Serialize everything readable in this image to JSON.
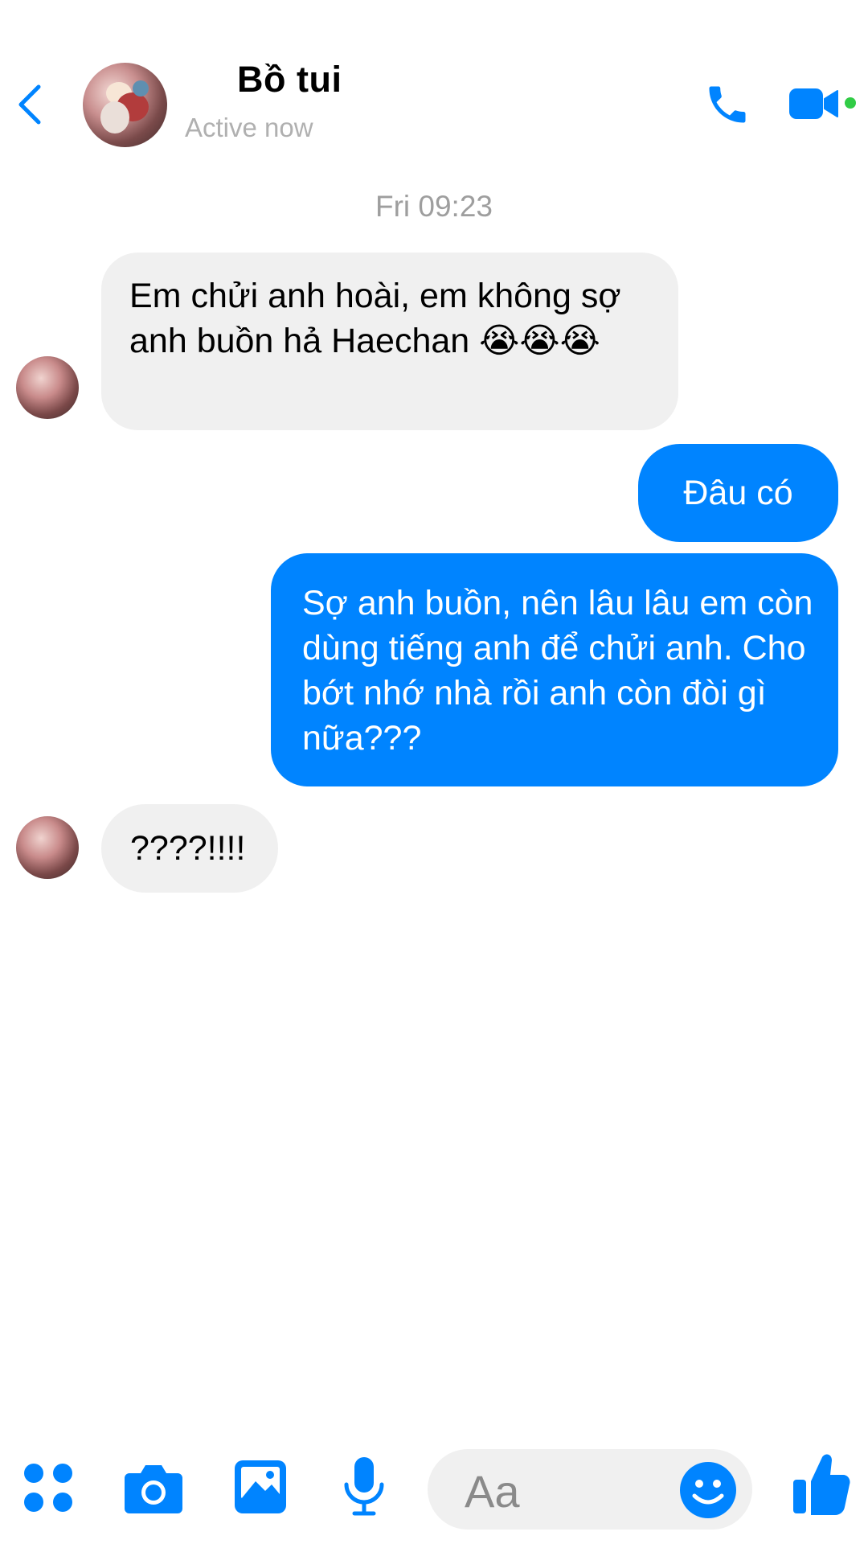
{
  "header": {
    "title": "Bồ tui",
    "status": "Active now"
  },
  "timestamp": "Fri 09:23",
  "messages": [
    {
      "direction": "incoming",
      "text": "Em chửi anh hoài, em không sợ anh buồn hả Haechan 😭😭😭"
    },
    {
      "direction": "outgoing",
      "text": "Đâu có"
    },
    {
      "direction": "outgoing",
      "text": "Sợ anh buồn, nên lâu lâu em còn dùng tiếng anh để chửi anh. Cho bớt nhớ nhà rồi anh còn đòi gì nữa???"
    },
    {
      "direction": "incoming",
      "text": "????!!!!"
    }
  ],
  "composer": {
    "placeholder": "Aa",
    "tools": [
      "apps-icon",
      "camera-icon",
      "image-icon",
      "microphone-icon",
      "emoji-icon",
      "like-icon"
    ]
  },
  "colors": {
    "accent": "#0084ff",
    "incoming_bubble": "#f0f0f0",
    "online": "#31cc46"
  }
}
